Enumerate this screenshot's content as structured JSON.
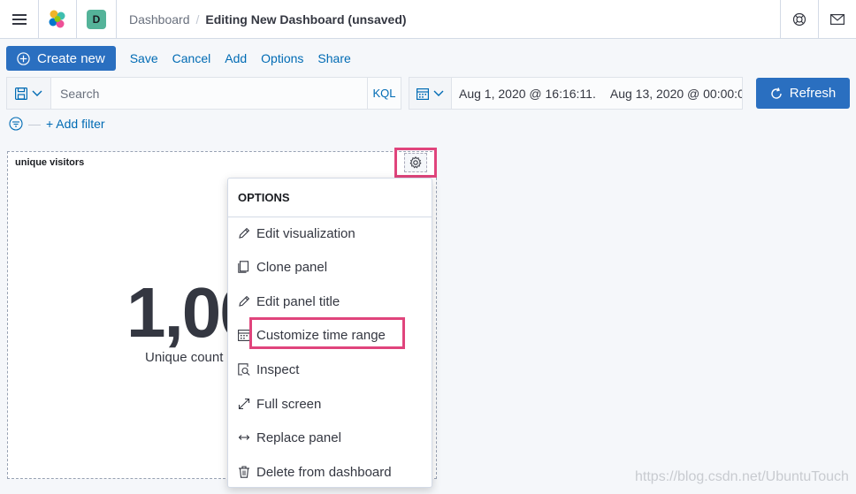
{
  "header": {
    "breadcrumb_parent": "Dashboard",
    "breadcrumb_separator": "/",
    "breadcrumb_current": "Editing New Dashboard (unsaved)",
    "space_initial": "D",
    "icons": [
      "menu-icon",
      "elastic-logo-icon",
      "help-icon",
      "mail-icon"
    ]
  },
  "topnav": {
    "create_label": "Create new",
    "links": [
      "Save",
      "Cancel",
      "Add",
      "Options",
      "Share"
    ]
  },
  "querybar": {
    "search_placeholder": "Search",
    "language": "KQL",
    "date_start": "Aug 1, 2020 @ 16:16:11.",
    "date_end": "Aug 13, 2020 @ 00:00:0",
    "refresh_label": "Refresh"
  },
  "filters": {
    "add_filter_label": "+ Add filter"
  },
  "panel": {
    "title": "unique visitors",
    "metric_value": "1,00",
    "metric_label": "Unique count"
  },
  "options_menu": {
    "title": "OPTIONS",
    "items": [
      {
        "label": "Edit visualization",
        "icon": "pencil-icon"
      },
      {
        "label": "Clone panel",
        "icon": "copy-icon"
      },
      {
        "label": "Edit panel title",
        "icon": "pencil-icon"
      },
      {
        "label": "Customize time range",
        "icon": "calendar-icon"
      },
      {
        "label": "Inspect",
        "icon": "inspect-icon"
      },
      {
        "label": "Full screen",
        "icon": "expand-icon"
      },
      {
        "label": "Replace panel",
        "icon": "swap-icon"
      },
      {
        "label": "Delete from dashboard",
        "icon": "trash-icon"
      }
    ]
  },
  "watermark": "https://blog.csdn.net/UbuntuTouch",
  "colors": {
    "primary": "#2a6fc0",
    "link": "#006bb4",
    "highlight": "#e0447c",
    "space_badge": "#54b399"
  }
}
